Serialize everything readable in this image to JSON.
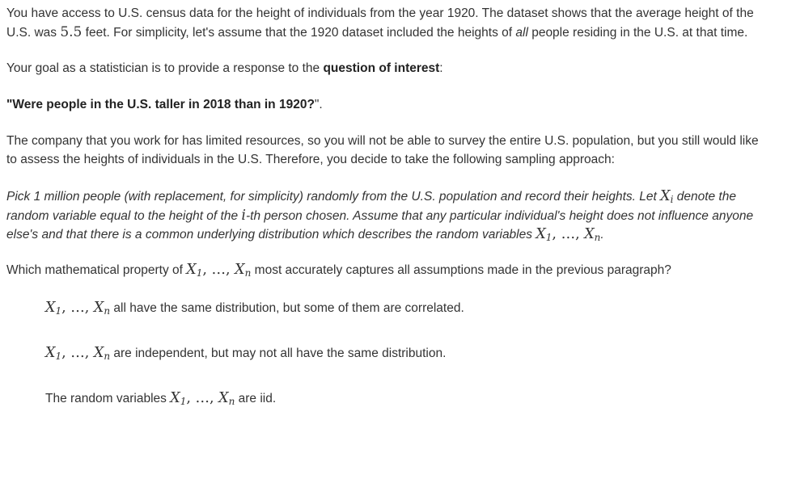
{
  "intro": {
    "t1": "You have access to U.S. census data for the height of individuals from the year 1920. The dataset shows that the average height of the U.S. was ",
    "value": "5.5",
    "t2": " feet. For simplicity, let's assume that the 1920 dataset included the heights of ",
    "emph": "all",
    "t3": " people residing in the U.S. at that time."
  },
  "goal": {
    "t1": "Your goal as a statistician is to provide a response to the ",
    "bold": "question of interest",
    "t2": ":"
  },
  "question": {
    "open": "\"",
    "bold": "Were people in the U.S. taller in 2018 than in 1920?",
    "close": "\"."
  },
  "company": {
    "text": "The company that you work for has limited resources, so you will not be able to survey the entire U.S. population, but you still would like to assess the heights of individuals in the U.S. Therefore, you decide to take the following sampling approach:"
  },
  "pick": {
    "t1": "Pick 1 million people (with replacement, for simplicity) randomly from the U.S. population and record their heights. Let ",
    "t2": " denote the random variable equal to the height of the ",
    "t3": "-th person chosen. Assume that any particular individual's height does not influence anyone else's and that there is a common underlying distribution which describes the random variables ",
    "t4": "."
  },
  "which": {
    "t1": "Which mathematical property of ",
    "t2": " most accurately captures all assumptions made in the previous paragraph?"
  },
  "math": {
    "X": "X",
    "i": "i",
    "one": "1",
    "n": "n",
    "sep": ", ",
    "dots": "…"
  },
  "options": [
    {
      "before": "",
      "after": " all have the same distribution, but some of them are correlated."
    },
    {
      "before": "",
      "after": " are independent, but may not all have the same distribution."
    },
    {
      "before": "The random variables ",
      "after": " are iid."
    }
  ]
}
